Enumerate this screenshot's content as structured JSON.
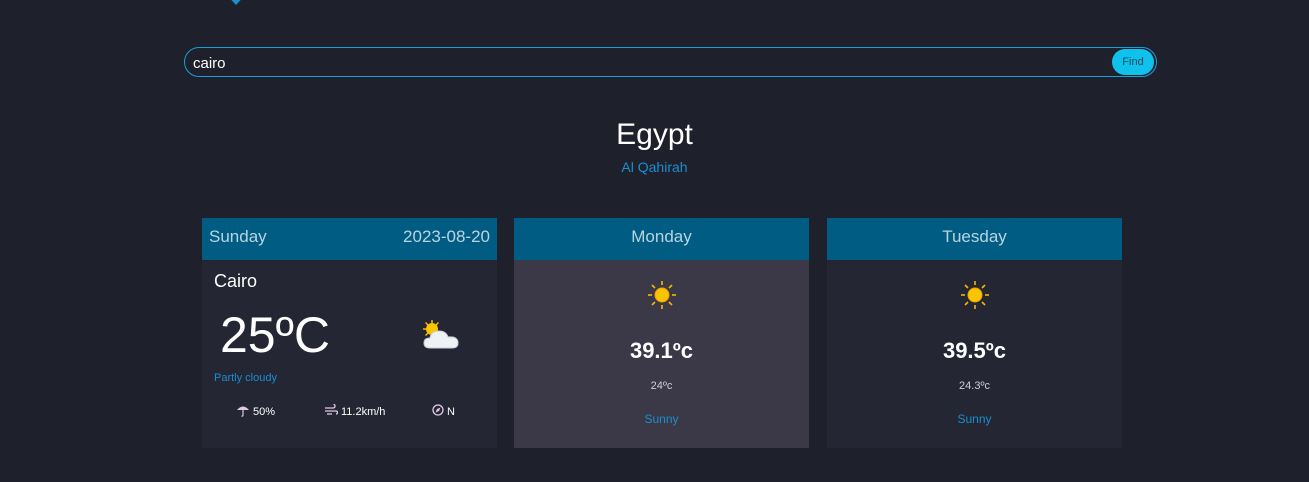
{
  "search": {
    "value": "cairo",
    "button_label": "Find"
  },
  "location": {
    "country": "Egypt",
    "region": "Al Qahirah"
  },
  "today": {
    "day": "Sunday",
    "date": "2023-08-20",
    "city": "Cairo",
    "temp": "25ºC",
    "condition": "Partly cloudy",
    "icon": "partly-cloudy-icon",
    "rain": "50%",
    "wind": "11.2km/h",
    "direction": "N"
  },
  "forecast": [
    {
      "day": "Monday",
      "max": "39.1ºc",
      "min": "24ºc",
      "condition": "Sunny",
      "icon": "sun-icon"
    },
    {
      "day": "Tuesday",
      "max": "39.5ºc",
      "min": "24.3ºc",
      "condition": "Sunny",
      "icon": "sun-icon"
    }
  ],
  "colors": {
    "background": "#1e202b",
    "card_header": "#005c82",
    "accent": "#0fc2ee",
    "link": "#1a8fd0"
  }
}
